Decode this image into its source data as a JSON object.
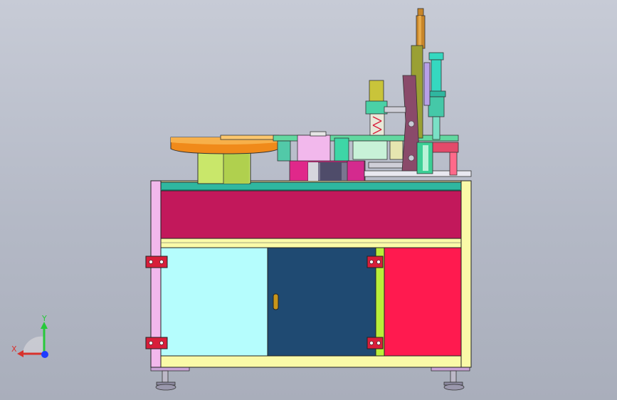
{
  "viewport": {
    "background": "#b9bdc9"
  },
  "model": {
    "colors": {
      "frame_pink": "#f2b8ec",
      "frame_yellow": "#fafaa8",
      "top_plate": "#2fb7a0",
      "drawer": "#c2185b",
      "door_left": "#b5fdfd",
      "door_middle": "#1f4a72",
      "door_green": "#b9ee3a",
      "door_right": "#ff1a4f",
      "bowl_orange": "#f08a1a",
      "bowl_base": "#c9e76a",
      "cylinder_brass": "#c8862a",
      "hinge_red": "#d81e3a",
      "handle_gold": "#c8951a"
    }
  },
  "triad": {
    "x_label": "X",
    "y_label": "Y",
    "x_color": "#d8322d",
    "y_color": "#27c93a",
    "z_color": "#1e3cff"
  }
}
